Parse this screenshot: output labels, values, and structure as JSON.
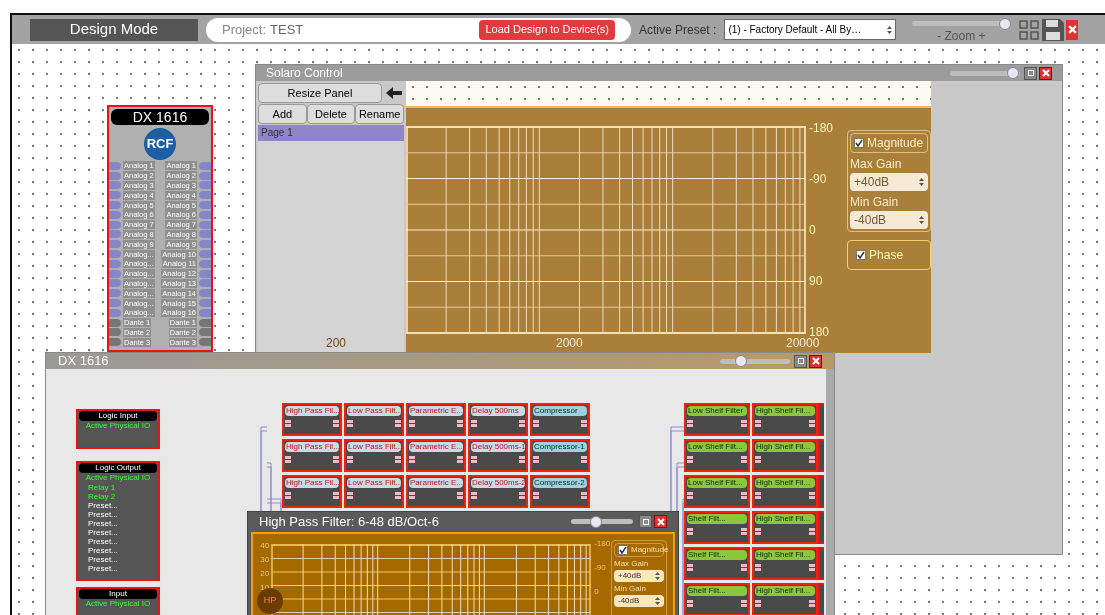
{
  "toolbar": {
    "mode": "Design Mode",
    "project_label": "Project:",
    "project": "TEST",
    "load_button": "Load Design to Device(s)",
    "preset_label": "Active Preset :",
    "preset": "(1) - Factory Default - All By…",
    "zoom": {
      "label": "- Zoom +",
      "level": 0.95
    }
  },
  "device": {
    "title": "DX 1616",
    "logo": "RCF",
    "channels": [
      {
        "kind": "analog",
        "left": "Analog 1",
        "right": "Analog 1"
      },
      {
        "kind": "analog",
        "left": "Analog 2",
        "right": "Analog 2"
      },
      {
        "kind": "analog",
        "left": "Analog 3",
        "right": "Analog 3"
      },
      {
        "kind": "analog",
        "left": "Analog 4",
        "right": "Analog 4"
      },
      {
        "kind": "analog",
        "left": "Analog 5",
        "right": "Analog 5"
      },
      {
        "kind": "analog",
        "left": "Analog 6",
        "right": "Analog 6"
      },
      {
        "kind": "analog",
        "left": "Analog 7",
        "right": "Analog 7"
      },
      {
        "kind": "analog",
        "left": "Analog 8",
        "right": "Analog 8"
      },
      {
        "kind": "analog",
        "left": "Analog 9",
        "right": "Analog 9"
      },
      {
        "kind": "analog",
        "left": "Analog...",
        "right": "Analog 10"
      },
      {
        "kind": "analog",
        "left": "Analog...",
        "right": "Analog 11"
      },
      {
        "kind": "analog",
        "left": "Analog...",
        "right": "Analog 12"
      },
      {
        "kind": "analog",
        "left": "Analog...",
        "right": "Analog 13"
      },
      {
        "kind": "analog",
        "left": "Analog...",
        "right": "Analog 14"
      },
      {
        "kind": "analog",
        "left": "Analog...",
        "right": "Analog 15"
      },
      {
        "kind": "analog",
        "left": "Analog...",
        "right": "Analog 16"
      },
      {
        "kind": "dante",
        "left": "Dante 1",
        "right": "Dante 1"
      },
      {
        "kind": "dante",
        "left": "Dante 2",
        "right": "Dante 2"
      },
      {
        "kind": "dante",
        "left": "Dante 3",
        "right": "Dante 3"
      }
    ]
  },
  "solaro": {
    "title": "Solaro Control",
    "level": 0.9,
    "resize_button": "Resize Panel",
    "page_buttons": [
      "Add",
      "Delete",
      "Rename"
    ],
    "pages": [
      {
        "label": "Page 1",
        "selected": true
      }
    ],
    "graph": {
      "right_labels": [
        "-180",
        "-90",
        "0",
        "90",
        "180"
      ],
      "x_labels": [
        "200",
        "2000",
        "20000"
      ]
    },
    "magnitude": {
      "label": "Magnitude",
      "checked": true
    },
    "max_gain": {
      "label": "Max Gain",
      "value": "+40dB"
    },
    "min_gain": {
      "label": "Min Gain",
      "value": "-40dB"
    },
    "phase": {
      "label": "Phase",
      "checked": true
    }
  },
  "dx_window": {
    "title": "DX 1616",
    "level": 0.3,
    "io_blocks": [
      {
        "title": "Logic Input",
        "subtitle": "Active Physical IO"
      },
      {
        "title": "Logic Output",
        "subtitle": "Active Physical IO",
        "items": [
          "Relay 1",
          "Relay 2",
          "Preset...",
          "Preset...",
          "Preset...",
          "Preset...",
          "Preset...",
          "Preset...",
          "Preset...",
          "Preset..."
        ]
      },
      {
        "title": "Input",
        "subtitle": "Active Physical IO"
      }
    ],
    "grid_left": [
      [
        {
          "kind": "eq",
          "label": "High Pass Fil...",
          "color": "#c5dbe6"
        },
        {
          "kind": "eq",
          "label": "Low Pass Filt...",
          "color": "#c5dbe6"
        },
        {
          "kind": "eq",
          "label": "Parametric E...",
          "color": "#c5dbe6"
        },
        {
          "kind": "eq",
          "label": "Delay 500ms",
          "color": "#c5dbe6"
        },
        {
          "kind": "dyn",
          "label": "Compressor",
          "color": "#9fd0e2"
        }
      ],
      [
        {
          "kind": "eq",
          "label": "High Pass Fil...",
          "color": "#c5dbe6"
        },
        {
          "kind": "eq",
          "label": "Low Pass Filt...",
          "color": "#c5dbe6"
        },
        {
          "kind": "eq",
          "label": "Parametric E...",
          "color": "#c5dbe6"
        },
        {
          "kind": "eq",
          "label": "Delay 500ms-1",
          "color": "#c5dbe6"
        },
        {
          "kind": "dyn",
          "label": "Compressor-1",
          "color": "#9fd0e2"
        }
      ],
      [
        {
          "kind": "eq",
          "label": "High Pass Fil...",
          "color": "#c5dbe6"
        },
        {
          "kind": "eq",
          "label": "Low Pass Filt...",
          "color": "#c5dbe6"
        },
        {
          "kind": "eq",
          "label": "Parametric E...",
          "color": "#c5dbe6"
        },
        {
          "kind": "eq",
          "label": "Delay 500ms-2",
          "color": "#c5dbe6"
        },
        {
          "kind": "dyn",
          "label": "Compressor-2",
          "color": "#9fd0e2"
        }
      ]
    ],
    "grid_right": [
      [
        {
          "kind": "dyn",
          "label": "Low Shelf Filter",
          "color": "#8cc63f"
        },
        {
          "kind": "dyn",
          "label": "High Shelf Fil...",
          "color": "#8cc63f"
        }
      ],
      [
        {
          "kind": "dyn",
          "label": "Low Shelf Filt...",
          "color": "#8cc63f"
        },
        {
          "kind": "dyn",
          "label": "High Shelf Fil...",
          "color": "#8cc63f"
        }
      ],
      [
        {
          "kind": "dyn",
          "label": "Low Shelf Filt...",
          "color": "#8cc63f"
        },
        {
          "kind": "dyn",
          "label": "High Shelf Fil...",
          "color": "#8cc63f"
        }
      ],
      [
        {
          "kind": "dyn",
          "label": "Shelf Filt...",
          "color": "#8cc63f"
        },
        {
          "kind": "dyn",
          "label": "High Shelf Fil...",
          "color": "#8cc63f"
        }
      ],
      [
        {
          "kind": "dyn",
          "label": "Shelf Filt...",
          "color": "#8cc63f"
        },
        {
          "kind": "dyn",
          "label": "High Shelf Fil...",
          "color": "#8cc63f"
        }
      ],
      [
        {
          "kind": "dyn",
          "label": "Shelf Filt...",
          "color": "#8cc63f"
        },
        {
          "kind": "dyn",
          "label": "High Shelf Fil...",
          "color": "#8cc63f"
        }
      ]
    ]
  },
  "hpf": {
    "title": "High Pass Filter: 6-48 dB/Oct-6",
    "level": 0.4,
    "left_labels": [
      "40",
      "30",
      "20",
      "10"
    ],
    "right_labels": [
      "-180",
      "-90",
      "0"
    ],
    "handle": "HP",
    "magnitude": {
      "label": "Magnitude",
      "checked": true
    },
    "max_gain": {
      "label": "Max Gain",
      "value": "+40dB"
    },
    "min_gain": {
      "label": "Min Gain",
      "value": "-40dB"
    }
  }
}
